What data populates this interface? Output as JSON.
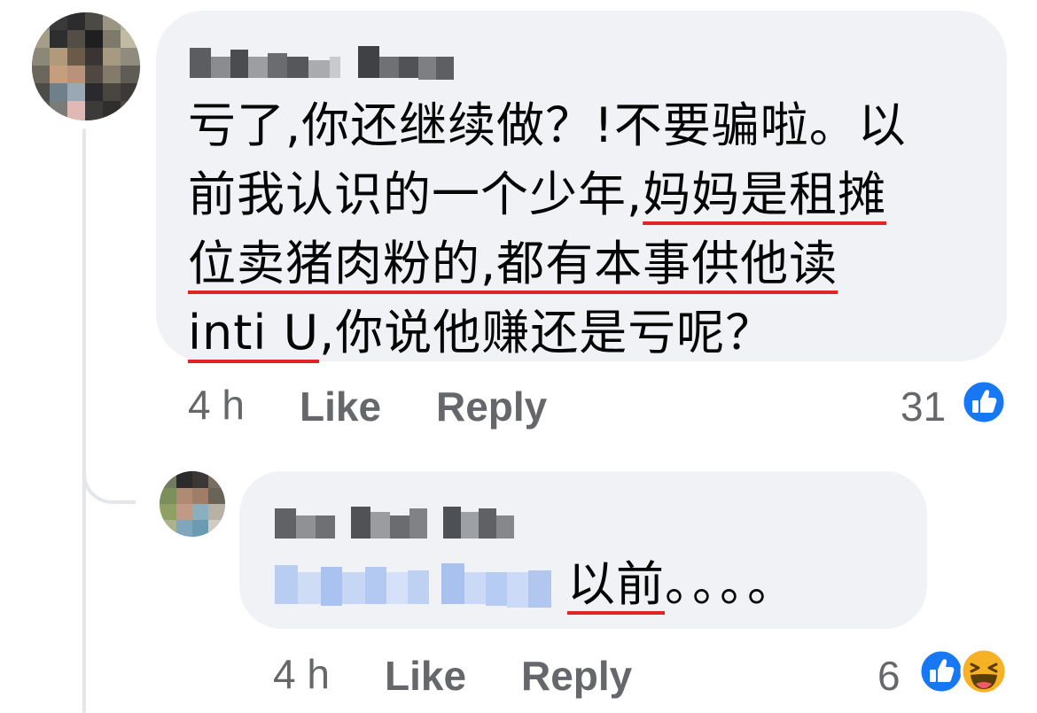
{
  "comments": [
    {
      "text_parts": [
        {
          "text": "亏了,你还继续做？!不要骗啦。以",
          "underline": false
        },
        {
          "text": "前我认识的一个少年,",
          "underline": false
        },
        {
          "text": "妈妈是租摊",
          "underline": true
        },
        {
          "text": "位卖猪肉粉的,都有本事供他读",
          "underline": true
        },
        {
          "text": "inti U",
          "underline": true
        },
        {
          "text": ",你说他赚还是亏呢？",
          "underline": false
        }
      ],
      "time": "4 h",
      "like_label": "Like",
      "reply_label": "Reply",
      "reaction_count": "31",
      "reactions": [
        "like-icon"
      ]
    },
    {
      "mention_blurred": true,
      "text_parts": [
        {
          "text": "以前",
          "underline": true
        },
        {
          "text": "。。。。",
          "underline": false
        }
      ],
      "time": "4 h",
      "like_label": "Like",
      "reply_label": "Reply",
      "reaction_count": "6",
      "reactions": [
        "like-icon",
        "haha-icon"
      ]
    }
  ],
  "colors": {
    "bubble": "#f0f2f5",
    "meta_text": "#65676b",
    "underline": "#e02424",
    "like_blue": "#1877f2",
    "haha_yellow": "#f7b125"
  }
}
